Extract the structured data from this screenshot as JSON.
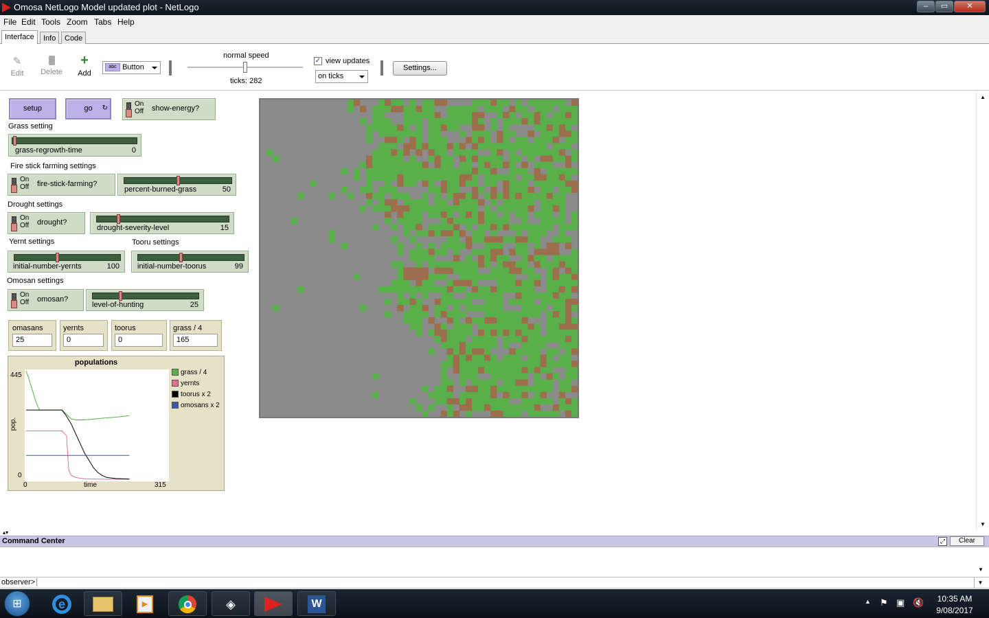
{
  "window": {
    "title": "Omosa NetLogo Model updated plot - NetLogo"
  },
  "menu": [
    "File",
    "Edit",
    "Tools",
    "Zoom",
    "Tabs",
    "Help"
  ],
  "tabs": [
    "Interface",
    "Info",
    "Code"
  ],
  "toolbar": {
    "edit": "Edit",
    "delete": "Delete",
    "add": "Add",
    "widget_type": "Button",
    "speed_label": "normal speed",
    "speed_level": 0.5,
    "ticks": "ticks: 282",
    "view_updates": "view updates",
    "view_updates_checked": true,
    "update_mode": "on ticks",
    "settings": "Settings..."
  },
  "controls": {
    "setup": "setup",
    "go": "go",
    "show_energy": "show-energy?",
    "on": "On",
    "off": "Off",
    "grass_setting": "Grass setting",
    "grass_regrowth": {
      "name": "grass-regrowth-time",
      "value": "0",
      "level": 0.0
    },
    "fire_settings": "Fire stick farming settings",
    "fire_stick": "fire-stick-farming?",
    "percent_burned": {
      "name": "percent-burned-grass",
      "value": "50",
      "level": 0.5
    },
    "drought_settings": "Drought settings",
    "drought": "drought?",
    "drought_severity": {
      "name": "drought-severity-level",
      "value": "15",
      "level": 0.15
    },
    "yernt_settings": "Yernt settings",
    "tooru_settings": "Tooru settings",
    "initial_yernts": {
      "name": "initial-number-yernts",
      "value": "100",
      "level": 0.4
    },
    "initial_toorus": {
      "name": "initial-number-toorus",
      "value": "99",
      "level": 0.4
    },
    "omosan_settings": "Omosan settings",
    "omosan": "omosan?",
    "level_hunting": {
      "name": "level-of-hunting",
      "value": "25",
      "level": 0.25
    }
  },
  "monitors": [
    {
      "label": "omasans",
      "value": "25"
    },
    {
      "label": "yernts",
      "value": "0"
    },
    {
      "label": "toorus",
      "value": "0"
    },
    {
      "label": "grass / 4",
      "value": "165"
    }
  ],
  "chart_data": {
    "type": "line",
    "title": "populations",
    "xlabel": "time",
    "ylabel": "pop.",
    "xlim": [
      0,
      315
    ],
    "ylim": [
      0,
      445
    ],
    "x_ticks": [
      "0",
      "315"
    ],
    "y_ticks": [
      "0",
      "445"
    ],
    "legend": "right",
    "series": [
      {
        "name": "grass / 4",
        "color": "#59b04a",
        "x": [
          0,
          5,
          10,
          15,
          20,
          25,
          30,
          40,
          60,
          80,
          100,
          110,
          130,
          150,
          170,
          200,
          230
        ],
        "y": [
          445,
          420,
          390,
          360,
          330,
          305,
          285,
          285,
          285,
          285,
          250,
          245,
          245,
          248,
          252,
          256,
          262
        ]
      },
      {
        "name": "yernts",
        "color": "#e0718f",
        "x": [
          0,
          40,
          60,
          80,
          90,
          95,
          100,
          110,
          130,
          150,
          180,
          230
        ],
        "y": [
          200,
          200,
          200,
          200,
          180,
          40,
          20,
          10,
          5,
          4,
          3,
          3
        ]
      },
      {
        "name": "toorus x 2",
        "color": "#000000",
        "x": [
          0,
          30,
          60,
          80,
          90,
          100,
          110,
          120,
          130,
          140,
          150,
          160,
          170,
          180,
          200,
          230
        ],
        "y": [
          285,
          285,
          285,
          285,
          260,
          230,
          190,
          150,
          110,
          80,
          50,
          30,
          18,
          10,
          6,
          4
        ]
      },
      {
        "name": "omosans x 2",
        "color": "#3b5ba8",
        "x": [
          0,
          230
        ],
        "y": [
          100,
          100
        ]
      }
    ]
  },
  "command_center": {
    "title": "Command Center",
    "clear": "Clear",
    "prompt": "observer>"
  },
  "taskbar": {
    "time": "10:35 AM",
    "date": "9/08/2017"
  },
  "colors": {
    "grass": "#59b04a",
    "dirt": "#9c6e4c",
    "empty": "#8b8b8b"
  }
}
